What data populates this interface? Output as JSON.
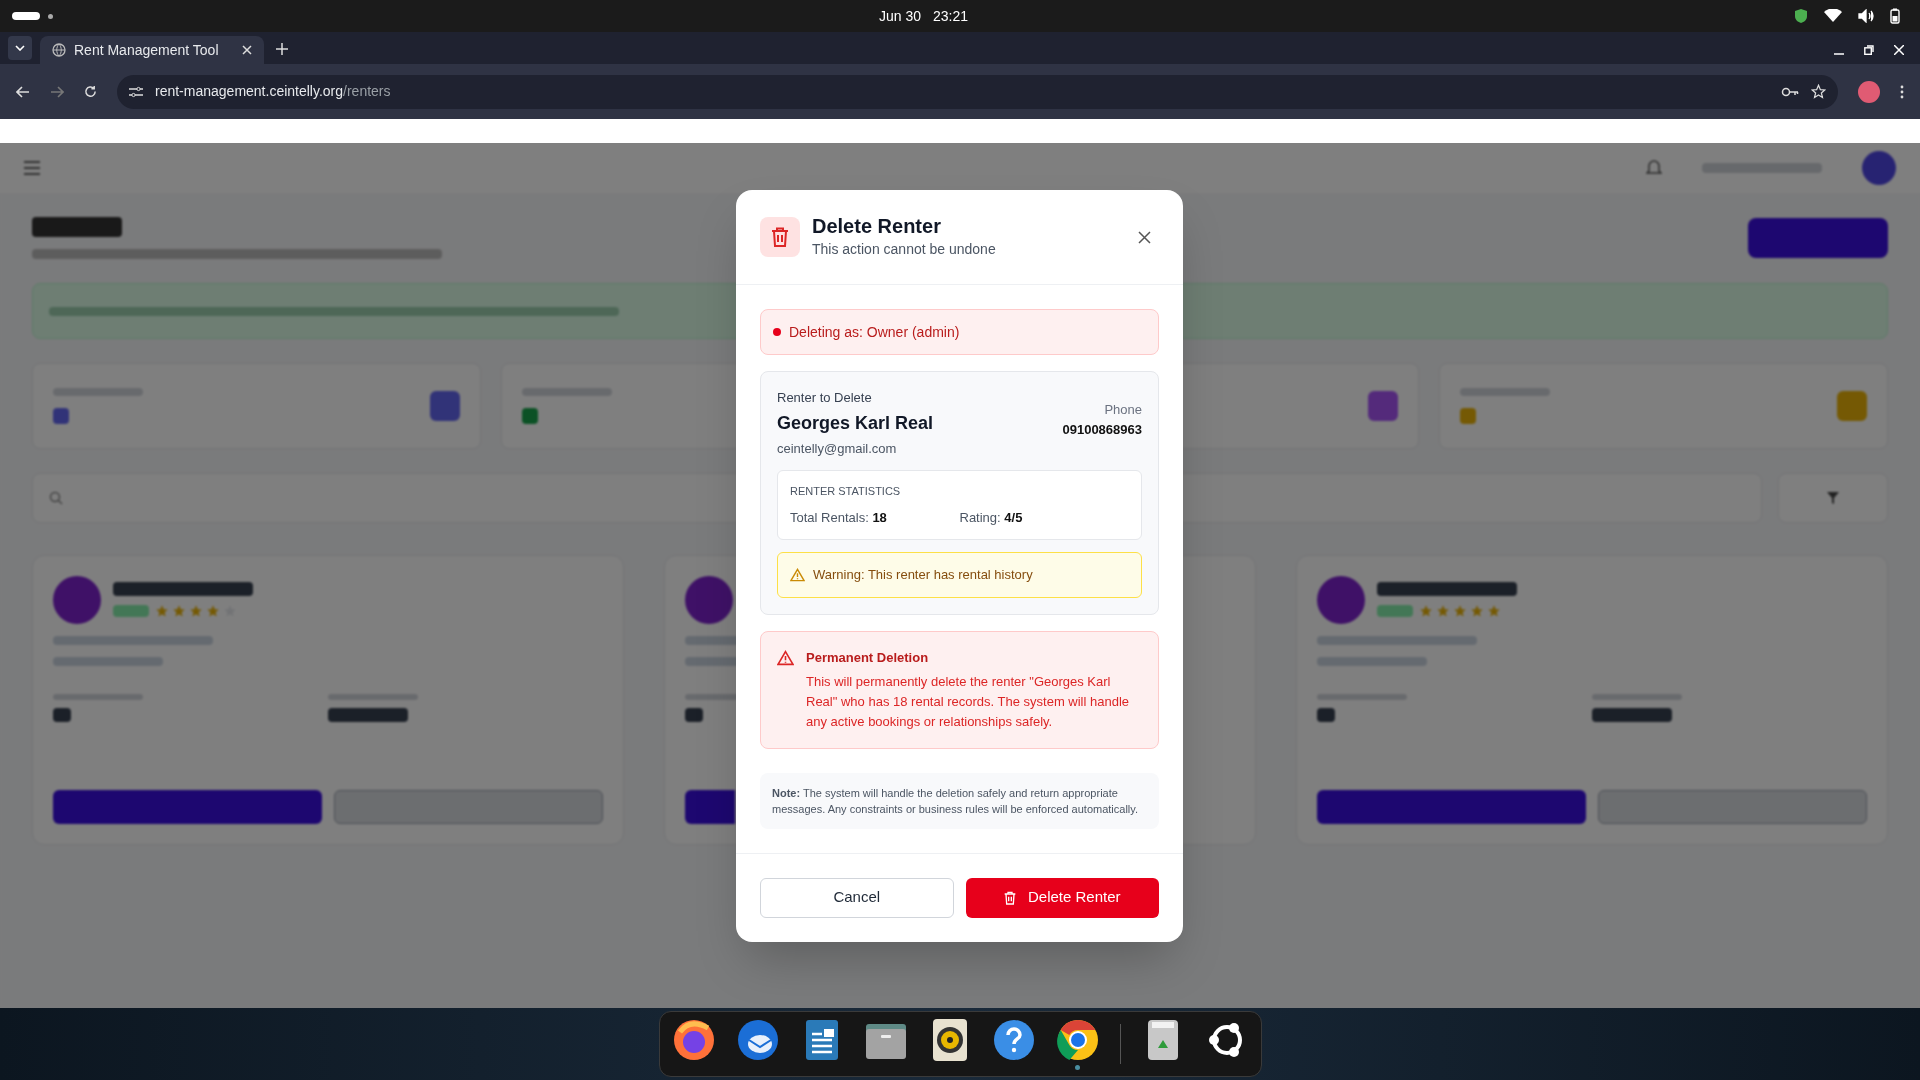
{
  "system_bar": {
    "date": "Jun 30",
    "time": "23:21"
  },
  "browser": {
    "tab_title": "Rent Management Tool",
    "url_host": "rent-management.ceintelly.org",
    "url_path": "/renters"
  },
  "page": {
    "cards": [
      {
        "kind": "renter",
        "stars": 4
      },
      {
        "kind": "covered"
      },
      {
        "kind": "renter",
        "stars": 5
      }
    ]
  },
  "dialog": {
    "title": "Delete Renter",
    "subtitle": "This action cannot be undone",
    "role_notice": "Deleting as: Owner (admin)",
    "renter": {
      "heading": "Renter to Delete",
      "name": "Georges Karl Real",
      "email": "ceintelly@gmail.com",
      "phone_label": "Phone",
      "phone": "09100868963"
    },
    "statistics": {
      "heading": "RENTER STATISTICS",
      "items": [
        {
          "label": "Total Rentals:",
          "value": "18"
        },
        {
          "label": "Rating:",
          "value": "4/5"
        }
      ]
    },
    "warning": "Warning: This renter has rental history",
    "danger": {
      "title": "Permanent Deletion",
      "text": "This will permanently delete the renter \"Georges Karl Real\" who has 18 rental records. The system will handle any active bookings or relationships safely."
    },
    "note": "**Note:** The system will handle the deletion safely and return appropriate messages. Any constraints or business rules will be enforced automatically.",
    "buttons": [
      {
        "label": "Cancel",
        "kind": "secondary"
      },
      {
        "label": "Delete Renter",
        "kind": "danger"
      }
    ]
  },
  "dock": [
    {
      "kind": "firefox",
      "running": false
    },
    {
      "kind": "mail",
      "running": false
    },
    {
      "kind": "writer",
      "running": false
    },
    {
      "kind": "files",
      "running": false
    },
    {
      "kind": "speaker",
      "running": false
    },
    {
      "kind": "help",
      "running": false
    },
    {
      "kind": "chrome",
      "running": true
    },
    {
      "kind": "trash",
      "running": false
    },
    {
      "kind": "apps",
      "running": false
    }
  ]
}
